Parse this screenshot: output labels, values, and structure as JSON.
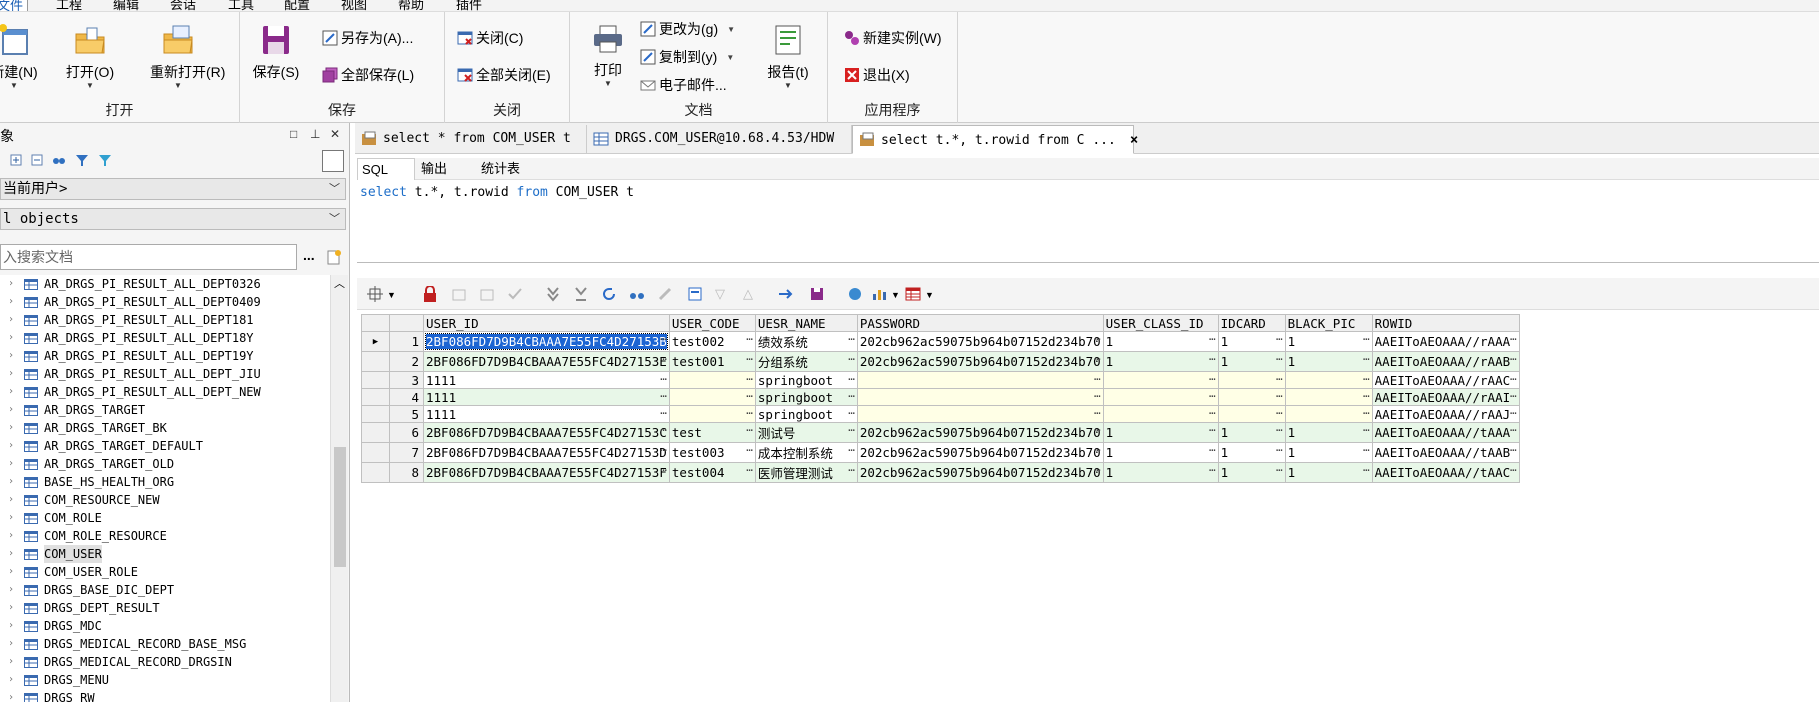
{
  "menu": {
    "items": [
      "文件",
      "工程",
      "编辑",
      "会话",
      "工具",
      "配置",
      "视图",
      "帮助",
      "插件"
    ]
  },
  "ribbon": {
    "open_group": {
      "label": "打开",
      "new": "新建(N)",
      "open": "打开(O)",
      "reopen": "重新打开(R)"
    },
    "save_group": {
      "label": "保存",
      "save": "保存(S)",
      "save_as": "另存为(A)...",
      "save_all": "全部保存(L)"
    },
    "close_group": {
      "label": "关闭",
      "close": "关闭(C)",
      "close_all": "全部关闭(E)"
    },
    "doc_group": {
      "label": "文档",
      "print": "打印",
      "change_to": "更改为(g)",
      "copy_to": "复制到(y)",
      "email": "电子邮件...",
      "report": "报告(t)"
    },
    "app_group": {
      "label": "应用程序",
      "new_instance": "新建实例(W)",
      "exit": "退出(X)"
    }
  },
  "left_panel": {
    "title": "象",
    "user_combo": "当前用户>",
    "objects_combo": "l objects",
    "search_placeholder": "入搜索文档",
    "search_btn": "...",
    "tree": [
      "AR_DRGS_PI_RESULT_ALL_DEPT0326",
      "AR_DRGS_PI_RESULT_ALL_DEPT0409",
      "AR_DRGS_PI_RESULT_ALL_DEPT181",
      "AR_DRGS_PI_RESULT_ALL_DEPT18Y",
      "AR_DRGS_PI_RESULT_ALL_DEPT19Y",
      "AR_DRGS_PI_RESULT_ALL_DEPT_JIU",
      "AR_DRGS_PI_RESULT_ALL_DEPT_NEW",
      "AR_DRGS_TARGET",
      "AR_DRGS_TARGET_BK",
      "AR_DRGS_TARGET_DEFAULT",
      "AR_DRGS_TARGET_OLD",
      "BASE_HS_HEALTH_ORG",
      "COM_RESOURCE_NEW",
      "COM_ROLE",
      "COM_ROLE_RESOURCE",
      "COM_USER",
      "COM_USER_ROLE",
      "DRGS_BASE_DIC_DEPT",
      "DRGS_DEPT_RESULT",
      "DRGS_MDC",
      "DRGS_MEDICAL_RECORD_BASE_MSG",
      "DRGS_MEDICAL_RECORD_DRGSIN",
      "DRGS_MENU",
      "DRGS_RW"
    ]
  },
  "tabs": [
    {
      "label": "select * from COM_USER t"
    },
    {
      "label": "DRGS.COM_USER@10.68.4.53/HDW"
    },
    {
      "label": "select t.*, t.rowid from C ...",
      "close": "×"
    }
  ],
  "subtabs": [
    "SQL",
    "输出",
    "统计表"
  ],
  "editor": {
    "kw1": "select",
    "mid": " t.*, t.rowid ",
    "kw2": "from",
    "tail": " COM_USER t"
  },
  "grid": {
    "columns": [
      "USER_ID",
      "USER_CODE",
      "UESR_NAME",
      "PASSWORD",
      "USER_CLASS_ID",
      "IDCARD",
      "BLACK_PIC",
      "ROWID"
    ],
    "rows": [
      [
        "2BF086FD7D9B4CBAAA7E55FC4D27153B",
        "test002",
        "绩效系统",
        "202cb962ac59075b964b07152d234b70",
        "1",
        "1",
        "1",
        "AAEIToAEOAAA//rAAA"
      ],
      [
        "2BF086FD7D9B4CBAAA7E55FC4D27153E",
        "test001",
        "分组系统",
        "202cb962ac59075b964b07152d234b70",
        "1",
        "1",
        "1",
        "AAEIToAEOAAA//rAAB"
      ],
      [
        "1111",
        "",
        "springboot",
        "",
        "",
        "",
        "",
        "AAEIToAEOAAA//rAAC"
      ],
      [
        "1111",
        "",
        "springboot",
        "",
        "",
        "",
        "",
        "AAEIToAEOAAA//rAAI"
      ],
      [
        "1111",
        "",
        "springboot",
        "",
        "",
        "",
        "",
        "AAEIToAEOAAA//rAAJ"
      ],
      [
        "2BF086FD7D9B4CBAAA7E55FC4D27153C",
        "test",
        "测试号",
        "202cb962ac59075b964b07152d234b70",
        "1",
        "1",
        "1",
        "AAEIToAEOAAA//tAAA"
      ],
      [
        "2BF086FD7D9B4CBAAA7E55FC4D27153D",
        "test003",
        "成本控制系统",
        "202cb962ac59075b964b07152d234b70",
        "1",
        "1",
        "1",
        "AAEIToAEOAAA//tAAB"
      ],
      [
        "2BF086FD7D9B4CBAAA7E55FC4D27153F",
        "test004",
        "医师管理测试",
        "202cb962ac59075b964b07152d234b70",
        "1",
        "1",
        "1",
        "AAEIToAEOAAA//tAAC"
      ]
    ],
    "row_numbers": [
      "1",
      "2",
      "3",
      "4",
      "5",
      "6",
      "7",
      "8"
    ],
    "selected_row": 1,
    "ellipsis": "…"
  },
  "colors": {
    "accent": "#1c64d2",
    "even_row": "#e8f7e8",
    "empty_cell": "#ffffe6",
    "keyword": "#1e6ec8"
  }
}
